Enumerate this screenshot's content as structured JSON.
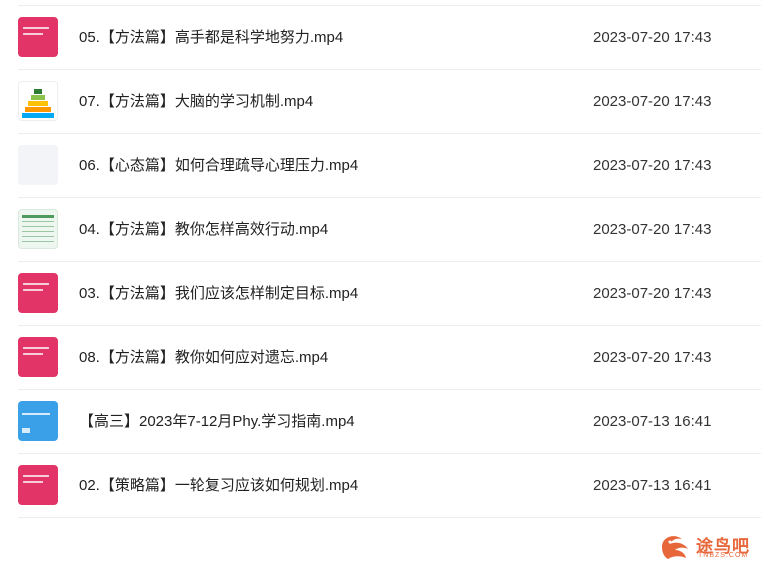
{
  "files": [
    {
      "name": "05.【方法篇】高手都是科学地努力.mp4",
      "date": "2023-07-20 17:43",
      "thumb_icon": "pink-slide-thumbnail"
    },
    {
      "name": "07.【方法篇】大脑的学习机制.mp4",
      "date": "2023-07-20 17:43",
      "thumb_icon": "pyramid-diagram-thumbnail"
    },
    {
      "name": "06.【心态篇】如何合理疏导心理压力.mp4",
      "date": "2023-07-20 17:43",
      "thumb_icon": "blank-thumbnail"
    },
    {
      "name": "04.【方法篇】教你怎样高效行动.mp4",
      "date": "2023-07-20 17:43",
      "thumb_icon": "table-thumbnail"
    },
    {
      "name": "03.【方法篇】我们应该怎样制定目标.mp4",
      "date": "2023-07-20 17:43",
      "thumb_icon": "pink-slide-thumbnail"
    },
    {
      "name": "08.【方法篇】教你如何应对遗忘.mp4",
      "date": "2023-07-20 17:43",
      "thumb_icon": "pink-slide-thumbnail"
    },
    {
      "name": "【高三】2023年7-12月Phy.学习指南.mp4",
      "date": "2023-07-13 16:41",
      "thumb_icon": "blue-slide-thumbnail"
    },
    {
      "name": "02.【策略篇】一轮复习应该如何规划.mp4",
      "date": "2023-07-13 16:41",
      "thumb_icon": "pink-slide-thumbnail"
    }
  ],
  "watermark": {
    "text": "途鸟吧",
    "sub": "TNBZS.COM",
    "color": "#e8673a"
  }
}
